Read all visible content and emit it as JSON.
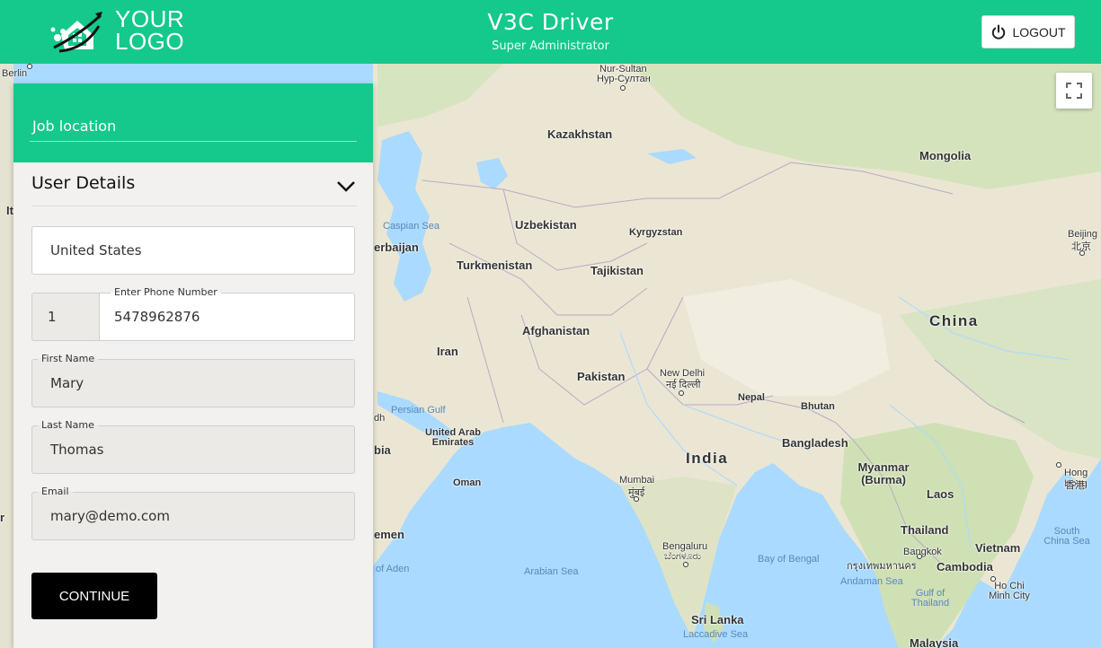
{
  "header": {
    "logo_line1": "YOUR",
    "logo_line2": "LOGO",
    "title": "V3C  Driver",
    "subtitle": "Super Administrator",
    "logout_label": "LOGOUT",
    "background_color": "#14c98b"
  },
  "map": {
    "fullscreen_icon": "fullscreen-icon",
    "labels": {
      "berlin": "Berlin",
      "nur_sultan": "Nur-Sultan",
      "nur_sultan_local": "Нур-Султан",
      "kazakhstan": "Kazakhstan",
      "mongolia": "Mongolia",
      "caspian_sea": "Caspian Sea",
      "uzbekistan": "Uzbekistan",
      "kyrgyzstan": "Kyrgyzstan",
      "azerbaijan": "erbaijan",
      "turkmenistan": "Turkmenistan",
      "tajikistan": "Tajikistan",
      "beijing": "Beijing",
      "beijing_local": "北京",
      "china": "China",
      "afghanistan": "Afghanistan",
      "iran": "Iran",
      "pakistan": "Pakistan",
      "new_delhi": "New Delhi",
      "new_delhi_local": "नई दिल्ली",
      "nepal": "Nepal",
      "bhutan": "Bhutan",
      "persian_gulf": "Persian Gulf",
      "dh": "dh",
      "bia": "bia",
      "uae": "United Arab Emirates",
      "bangladesh": "Bangladesh",
      "india": "India",
      "oman": "Oman",
      "myanmar": "Myanmar (Burma)",
      "hong_kong": "Hong Kong",
      "hong_kong_local": "香港",
      "mumbai": "Mumbai",
      "mumbai_local": "मुंबई",
      "laos": "Laos",
      "south_china_sea": "South China Sea",
      "yemen": "emen",
      "thailand": "Thailand",
      "bangkok": "Bangkok",
      "bangkok_local": "กรุงเทพมหานคร",
      "vietnam": "Vietnam",
      "bengaluru": "Bengaluru",
      "bengaluru_local": "ಬೆಂಗಳೂರು",
      "bay_of_bengal": "Bay of Bengal",
      "cambodia": "Cambodia",
      "gulf_of_aden": "of Aden",
      "arabian_sea": "Arabian Sea",
      "andaman_sea": "Andaman Sea",
      "gulf_of_thailand": "Gulf of Thailand",
      "ho_chi_minh": "Ho Chi Minh City",
      "sri_lanka": "Sri Lanka",
      "laccadive_sea": "Laccadive Sea",
      "malaysia": "Malaysia",
      "edge_it": "It",
      "edge_r": "r"
    }
  },
  "panel": {
    "job_location_label": "Job location",
    "section_title": "User Details",
    "country_value": "United States",
    "phone_code": "1",
    "phone_label": "Enter Phone Number",
    "phone_value": "5478962876",
    "first_name_label": "First Name",
    "first_name_value": "Mary",
    "last_name_label": "Last Name",
    "last_name_value": "Thomas",
    "email_label": "Email",
    "email_value": "mary@demo.com",
    "continue_label": "CONTINUE"
  }
}
